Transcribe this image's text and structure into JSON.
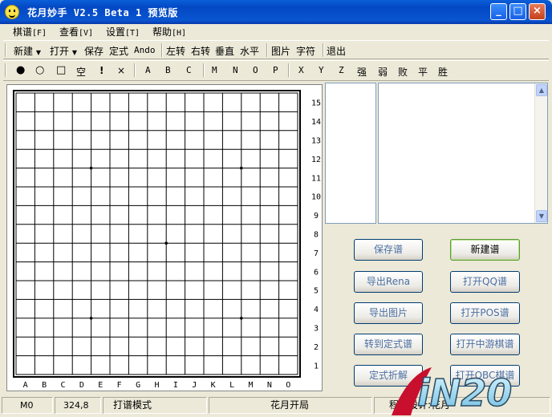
{
  "window": {
    "title": "花月妙手 V2.5 Beta 1 预览版",
    "minimize": "_",
    "maximize": "□",
    "close": "×"
  },
  "menu": [
    {
      "label": "棋谱",
      "hotkey": "[F]"
    },
    {
      "label": "查看",
      "hotkey": "[V]"
    },
    {
      "label": "设置",
      "hotkey": "[T]"
    },
    {
      "label": "帮助",
      "hotkey": "[H]"
    }
  ],
  "toolbar1": {
    "new": "新建",
    "open": "打开",
    "save": "保存",
    "joseki": "定式",
    "ando": "Ando",
    "rotate_left": "左转",
    "rotate_right": "右转",
    "vertical": "垂直",
    "horizontal": "水平",
    "image": "图片",
    "text": "字符",
    "exit": "退出"
  },
  "toolbar2": {
    "black": "●",
    "white": "○",
    "square": "□",
    "empty": "空",
    "bang": "!",
    "cross": "×",
    "A": "A",
    "B": "B",
    "C": "C",
    "M": "M",
    "N": "N",
    "O": "O",
    "P": "P",
    "X": "X",
    "Y": "Y",
    "Z": "Z",
    "strong": "强",
    "weak": "弱",
    "lose": "败",
    "draw": "平",
    "win": "胜"
  },
  "board": {
    "size": 15,
    "columns": [
      "A",
      "B",
      "C",
      "D",
      "E",
      "F",
      "G",
      "H",
      "I",
      "J",
      "K",
      "L",
      "M",
      "N",
      "O"
    ],
    "rows": [
      "15",
      "14",
      "13",
      "12",
      "11",
      "10",
      "9",
      "8",
      "7",
      "6",
      "5",
      "4",
      "3",
      "2",
      "1"
    ],
    "star_points": [
      "D12",
      "L12",
      "H8",
      "D4",
      "L4"
    ]
  },
  "buttons": {
    "save_record": "保存谱",
    "new_record": "新建谱",
    "export_rena": "导出Rena",
    "open_qq": "打开QQ谱",
    "export_image": "导出图片",
    "open_pos": "打开POS谱",
    "goto_joseki": "转到定式谱",
    "open_zhongyou": "打开中游棋谱",
    "joseki_solve": "定式折解",
    "open_obc": "打开OBC棋谱"
  },
  "status": {
    "move": "M0",
    "coords": "324,8",
    "mode": "打谱模式",
    "opening": "花月开局",
    "design": "程序设计:花月"
  },
  "watermark": "iN20"
}
